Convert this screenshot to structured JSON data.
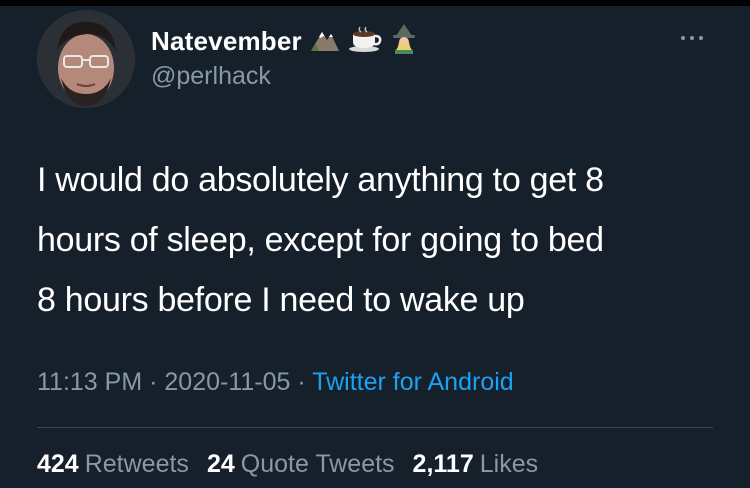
{
  "user": {
    "display_name": "Natevember",
    "handle": "@perlhack",
    "name_emojis": [
      "mountain-icon",
      "coffee-icon",
      "mage-icon"
    ]
  },
  "tweet": {
    "lines": [
      "I would do absolutely anything to get 8",
      "hours of sleep, except for going to bed",
      "8 hours before I need to wake up"
    ]
  },
  "meta": {
    "time": "11:13 PM",
    "separator": "·",
    "date": "2020-11-05",
    "source": "Twitter for Android"
  },
  "stats": {
    "retweets": {
      "count": "424",
      "label": "Retweets"
    },
    "quotes": {
      "count": "24",
      "label": "Quote Tweets"
    },
    "likes": {
      "count": "2,117",
      "label": "Likes"
    }
  },
  "colors": {
    "background": "#15202b",
    "secondary_text": "#8899a6",
    "link": "#1da1f2",
    "divider": "#38444d"
  }
}
